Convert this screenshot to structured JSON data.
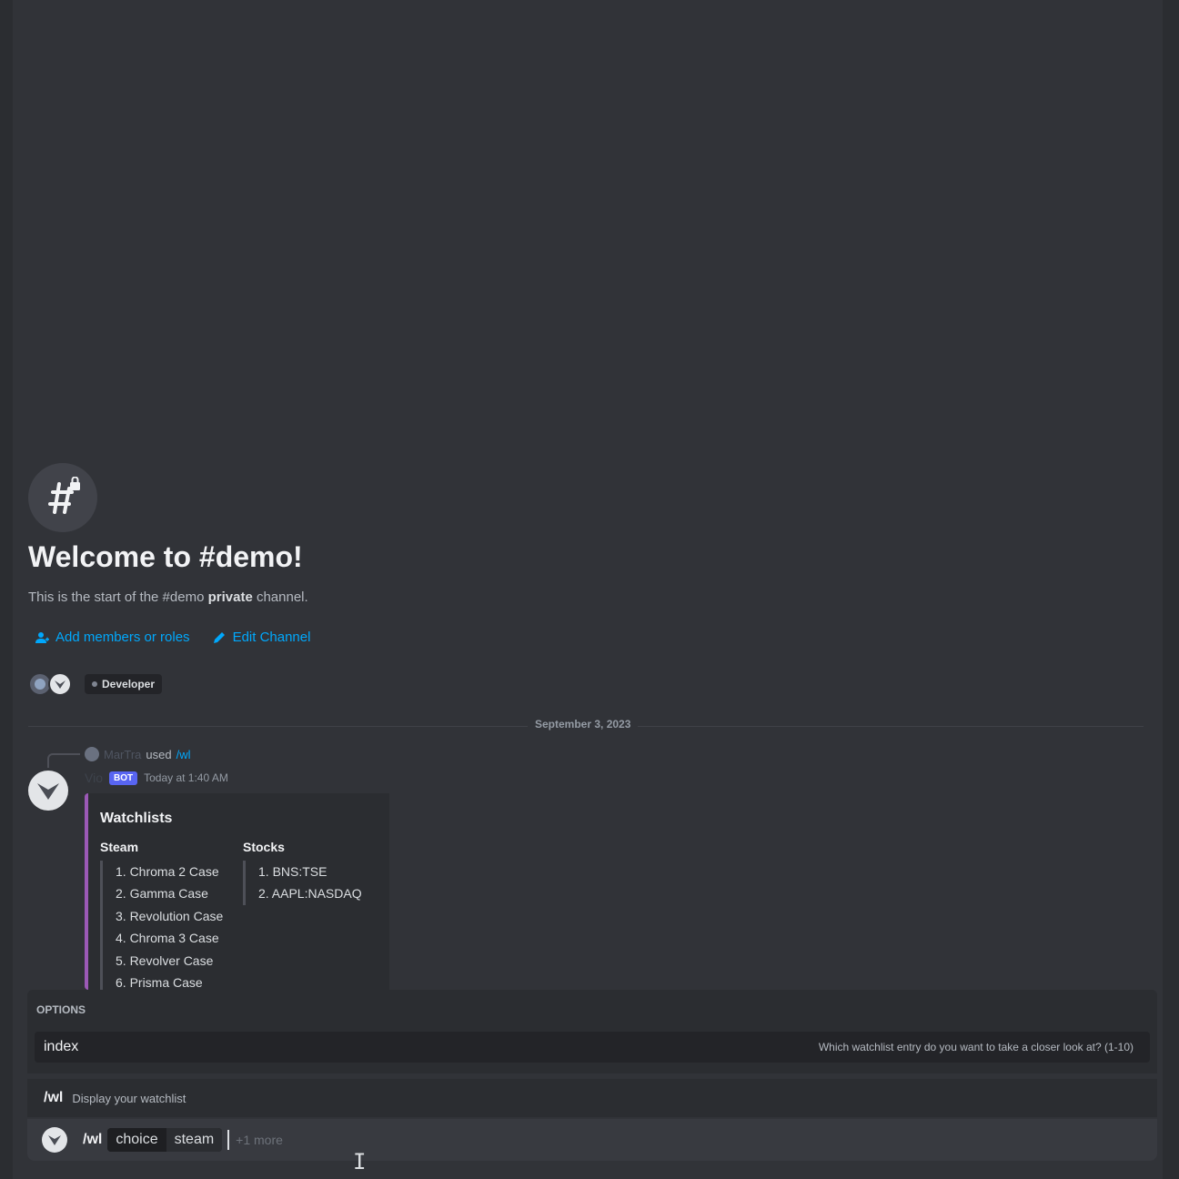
{
  "welcome": {
    "title": "Welcome to #demo!",
    "subtitle_pre": "This is the start of the #demo ",
    "subtitle_bold": "private",
    "subtitle_post": " channel."
  },
  "actions": {
    "add_members": "Add members or roles",
    "edit_channel": "Edit Channel"
  },
  "role": {
    "label": "Developer"
  },
  "divider": {
    "date": "September 3, 2023"
  },
  "reply": {
    "user": "MarTra",
    "used": "used",
    "command": "/wl"
  },
  "message": {
    "author": "Vio",
    "badge": "BOT",
    "timestamp": "Today at 1:40 AM",
    "embed": {
      "title": "Watchlists",
      "columns": [
        {
          "heading": "Steam",
          "items": [
            "1. Chroma 2 Case",
            "2. Gamma Case",
            "3. Revolution Case",
            "4. Chroma 3 Case",
            "5. Revolver Case",
            "6. Prisma Case"
          ]
        },
        {
          "heading": "Stocks",
          "items": [
            "1. BNS:TSE",
            "2. AAPL:NASDAQ"
          ]
        }
      ]
    }
  },
  "options": {
    "label": "OPTIONS",
    "items": [
      {
        "name": "index",
        "description": "Which watchlist entry do you want to take a closer look at? (1-10)"
      }
    ]
  },
  "command": {
    "name": "/wl",
    "description": "Display your watchlist"
  },
  "input": {
    "command": "/wl",
    "param_key": "choice",
    "param_value": "steam",
    "more": "+1 more"
  },
  "colors": {
    "background": "#313338",
    "accent_link": "#00a8fc",
    "bot_badge": "#5865f2",
    "embed_bar": "#9b59b6"
  }
}
